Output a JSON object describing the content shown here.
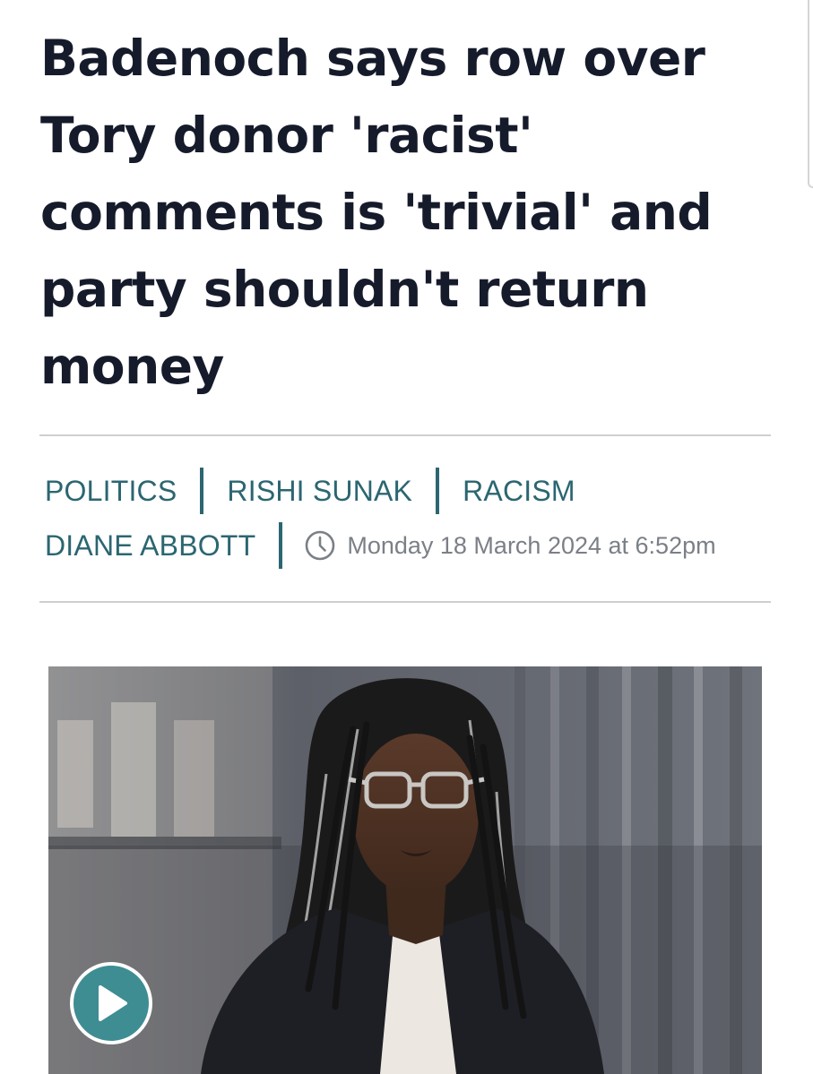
{
  "article": {
    "headline": "Badenoch says row over Tory donor 'racist' comments is 'trivial' and party shouldn't return money",
    "tags": [
      "POLITICS",
      "RISHI SUNAK",
      "RACISM",
      "DIANE ABBOTT"
    ],
    "timestamp": "Monday 18 March 2024 at 6:52pm",
    "timestamp_icon": "clock-icon",
    "media": {
      "type": "video",
      "play_icon": "play-icon"
    }
  },
  "colors": {
    "headline": "#161b2b",
    "tag": "#2b6671",
    "timestamp": "#7b7f86",
    "divider": "#cfcfcf",
    "play_button": "#3e8d93"
  }
}
